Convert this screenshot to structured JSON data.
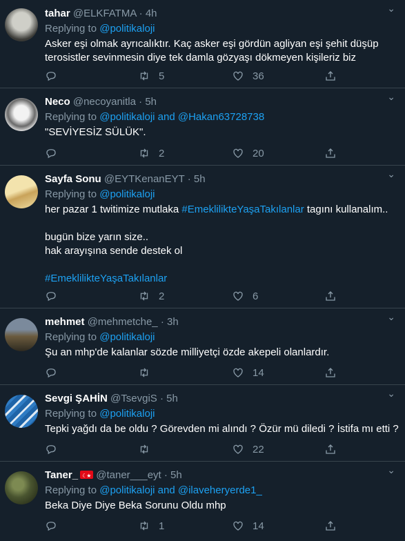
{
  "tweets": [
    {
      "name": "tahar",
      "handle": "@ELKFATMA",
      "time": "4h",
      "reply_prefix": "Replying to ",
      "reply_to": [
        "@politikaloji"
      ],
      "lines": [
        "Asker eşi olmak ayrıcalıktır. Kaç asker eşi gördün agliyan eşi şehit düşüp",
        "terosistler sevinmesin diye tek damla gözyaşı dökmeyen kişileriz biz"
      ],
      "replies": "",
      "retweets": "5",
      "likes": "36",
      "avatar_colors": [
        "#c9c9c2",
        "#3a3a36"
      ]
    },
    {
      "name": "Neco",
      "handle": "@necoyanitla",
      "time": "5h",
      "reply_prefix": "Replying to ",
      "reply_to": [
        "@politikaloji",
        "@Hakan63728738"
      ],
      "reply_and": " and ",
      "lines": [
        "\"SEVİYESİZ SÜLÜK\"."
      ],
      "replies": "",
      "retweets": "2",
      "likes": "20",
      "avatar_colors": [
        "#e8e8e8",
        "#555555"
      ]
    },
    {
      "name": "Sayfa Sonu",
      "handle": "@EYTKenanEYT",
      "time": "5h",
      "reply_prefix": "Replying to ",
      "reply_to": [
        "@politikaloji"
      ],
      "line1_pre": "her pazar 1 twitimize mutlaka ",
      "line1_hash": "#EmeklilikteYaşaTakılanlar",
      "line1_post": " tagını kullanalım..",
      "line2": "bugün bize yarın size..",
      "line3": "hak arayışına sende destek ol",
      "hashtag": "#EmeklilikteYaşaTakılanlar",
      "replies": "",
      "retweets": "2",
      "likes": "6",
      "avatar_colors": [
        "#e8d59a",
        "#b38f4a"
      ]
    },
    {
      "name": "mehmet",
      "handle": "@mehmetche_",
      "time": "3h",
      "reply_prefix": "Replying to ",
      "reply_to": [
        "@politikaloji"
      ],
      "lines": [
        "Şu an mhp'de kalanlar sözde milliyetçi özde akepeli olanlardır."
      ],
      "replies": "",
      "retweets": "",
      "likes": "14",
      "avatar_colors": [
        "#6b6450",
        "#2e3b4a"
      ]
    },
    {
      "name": "Sevgi ŞAHİN",
      "handle": "@TsevgiS",
      "time": "5h",
      "reply_prefix": "Replying to ",
      "reply_to": [
        "@politikaloji"
      ],
      "lines": [
        "Tepki yağdı da be oldu ? Görevden mi alındı ? Özür mü diledi ? İstifa mı etti ?"
      ],
      "replies": "",
      "retweets": "",
      "likes": "22",
      "avatar_colors": [
        "#2a6fb0",
        "#d8e6f2"
      ]
    },
    {
      "name": "Taner_",
      "handle": "@taner___eyt",
      "time": "5h",
      "reply_prefix": "Replying to ",
      "reply_to": [
        "@politikaloji",
        "@ilaveheryerde1_"
      ],
      "reply_and": " and ",
      "lines": [
        "Beka Diye Diye Beka Sorunu Oldu mhp"
      ],
      "replies": "",
      "retweets": "1",
      "likes": "14",
      "avatar_colors": [
        "#5d6a3e",
        "#2c331c"
      ]
    }
  ],
  "separator": "·",
  "icons": [
    "reply-icon",
    "retweet-icon",
    "like-icon",
    "share-icon",
    "caret-down-icon"
  ],
  "colors": {
    "background": "#15202b",
    "link": "#1da1f2",
    "muted": "#8899a6",
    "border": "#38444d"
  }
}
